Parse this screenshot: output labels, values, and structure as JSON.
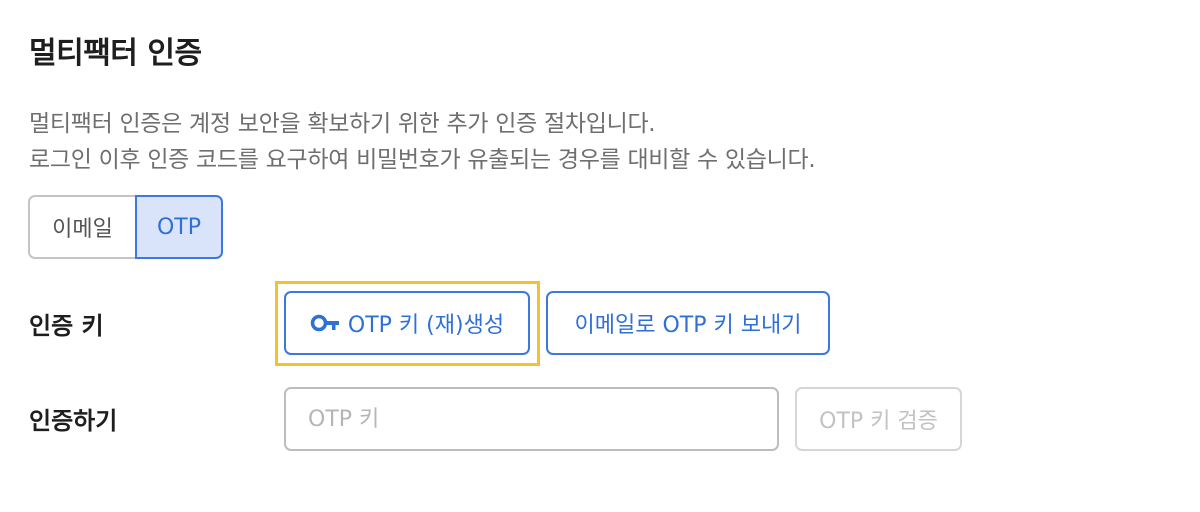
{
  "page": {
    "title": "멀티팩터 인증",
    "description": [
      "멀티팩터 인증은 계정 보안을 확보하기 위한 추가 인증 절차입니다.",
      "로그인 이후 인증 코드를 요구하여 비밀번호가 유출되는 경우를 대비할 수 있습니다."
    ]
  },
  "method_toggle": {
    "options": [
      "이메일",
      "OTP"
    ],
    "selected": "OTP"
  },
  "auth_key": {
    "label": "인증 키",
    "generate_button": "OTP 키 (재)생성",
    "generate_icon": "key-icon",
    "send_email_button": "이메일로 OTP 키 보내기"
  },
  "verify": {
    "label": "인증하기",
    "input_placeholder": "OTP 키",
    "input_value": "",
    "verify_button": "OTP 키 검증",
    "verify_button_disabled": true
  },
  "colors": {
    "accent": "#2f6fd8",
    "accent_bg": "#d9e4fb",
    "highlight": "#f3c22e",
    "disabled": "#c2c2c2"
  }
}
